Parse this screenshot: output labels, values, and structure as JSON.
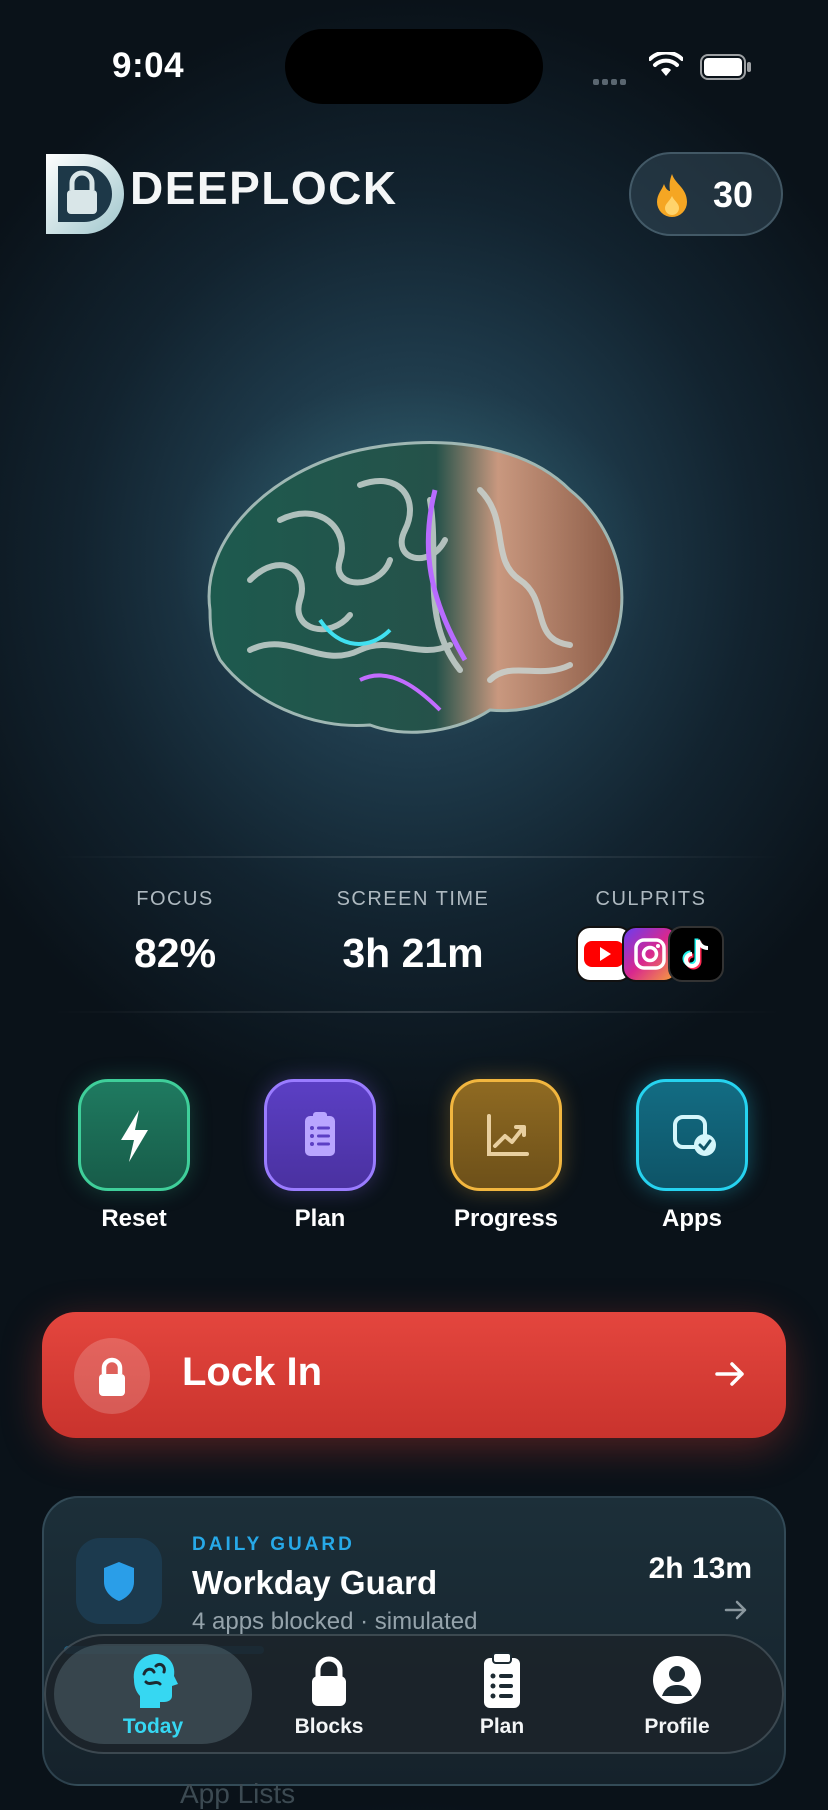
{
  "status_bar": {
    "time": "9:04"
  },
  "header": {
    "brand": "DEEPLOCK",
    "streak": "30"
  },
  "stats": [
    {
      "label": "FOCUS",
      "value": "82%"
    },
    {
      "label": "SCREEN TIME",
      "value": "3h 21m"
    },
    {
      "label": "CULPRITS",
      "apps": [
        "youtube-icon",
        "instagram-icon",
        "tiktok-icon"
      ]
    }
  ],
  "quick_actions": [
    {
      "label": "Reset",
      "icon": "lightning-icon"
    },
    {
      "label": "Plan",
      "icon": "clipboard-icon"
    },
    {
      "label": "Progress",
      "icon": "chart-icon"
    },
    {
      "label": "Apps",
      "icon": "app-check-icon"
    }
  ],
  "lock_in": {
    "label": "Lock In"
  },
  "daily_guard": {
    "eyebrow": "DAILY GUARD",
    "title": "Workday Guard",
    "subtitle": "4 apps blocked · simulated",
    "time": "2h 13m"
  },
  "next_card_peek": "App Lists",
  "tab_bar": {
    "tabs": [
      {
        "label": "Today",
        "active": true
      },
      {
        "label": "Blocks",
        "active": false
      },
      {
        "label": "Plan",
        "active": false
      },
      {
        "label": "Profile",
        "active": false
      }
    ]
  },
  "colors": {
    "lock_in": "#d93c35",
    "accent_cyan": "#36d7f2",
    "eyebrow_blue": "#27a9e8"
  }
}
